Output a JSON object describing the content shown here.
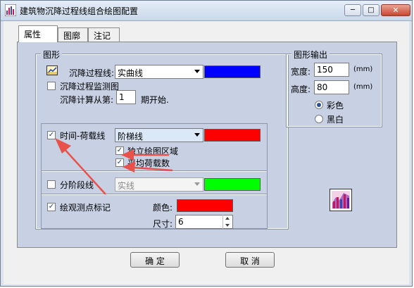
{
  "window": {
    "title": "建筑物沉降过程线组合绘图配置",
    "minimize_glyph": "─",
    "maximize_glyph": "□",
    "close_glyph": "✕"
  },
  "tabs": [
    {
      "label": "属性",
      "active": true
    },
    {
      "label": "图廓",
      "active": false
    },
    {
      "label": "注记",
      "active": false
    }
  ],
  "shape_group": {
    "title": "图形",
    "settlement_curve_label": "沉降过程线:",
    "settlement_curve_value": "实曲线",
    "settlement_curve_color": "#0000ff",
    "monitor_chart_label": "沉降过程监测图",
    "monitor_chart_checked": false,
    "calc_from_label": "沉降计算从第:",
    "calc_from_value": "1",
    "calc_from_suffix": "期开始.",
    "time_load_label": "时间-荷载线",
    "time_load_checked": true,
    "time_load_value": "阶梯线",
    "time_load_color": "#ff0000",
    "independent_area_label": "独立绘图区域",
    "independent_area_checked": true,
    "avg_load_label": "平均荷载数",
    "avg_load_checked": true,
    "staged_line_label": "分阶段线",
    "staged_line_checked": false,
    "staged_line_value": "实线",
    "staged_line_color": "#00ff00",
    "obs_mark_label": "绘观测点标记",
    "obs_mark_checked": true,
    "mark_color_label": "颜色:",
    "mark_color": "#ff0000",
    "mark_size_label": "尺寸:",
    "mark_size_value": "6"
  },
  "output_group": {
    "title": "图形输出",
    "width_label": "宽度:",
    "width_value": "150",
    "width_unit": "(mm)",
    "height_label": "高度:",
    "height_value": "80",
    "height_unit": "(mm)",
    "color_option": "彩色",
    "bw_option": "黑白",
    "selected": "彩色"
  },
  "icons": {
    "app": "chart-app-icon",
    "curve": "settlement-curve-icon",
    "preview": "chart-preview-icon"
  },
  "colors": {
    "annotation_arrows": "#e8524a"
  },
  "buttons": {
    "ok": "确 定",
    "cancel": "取 消"
  }
}
